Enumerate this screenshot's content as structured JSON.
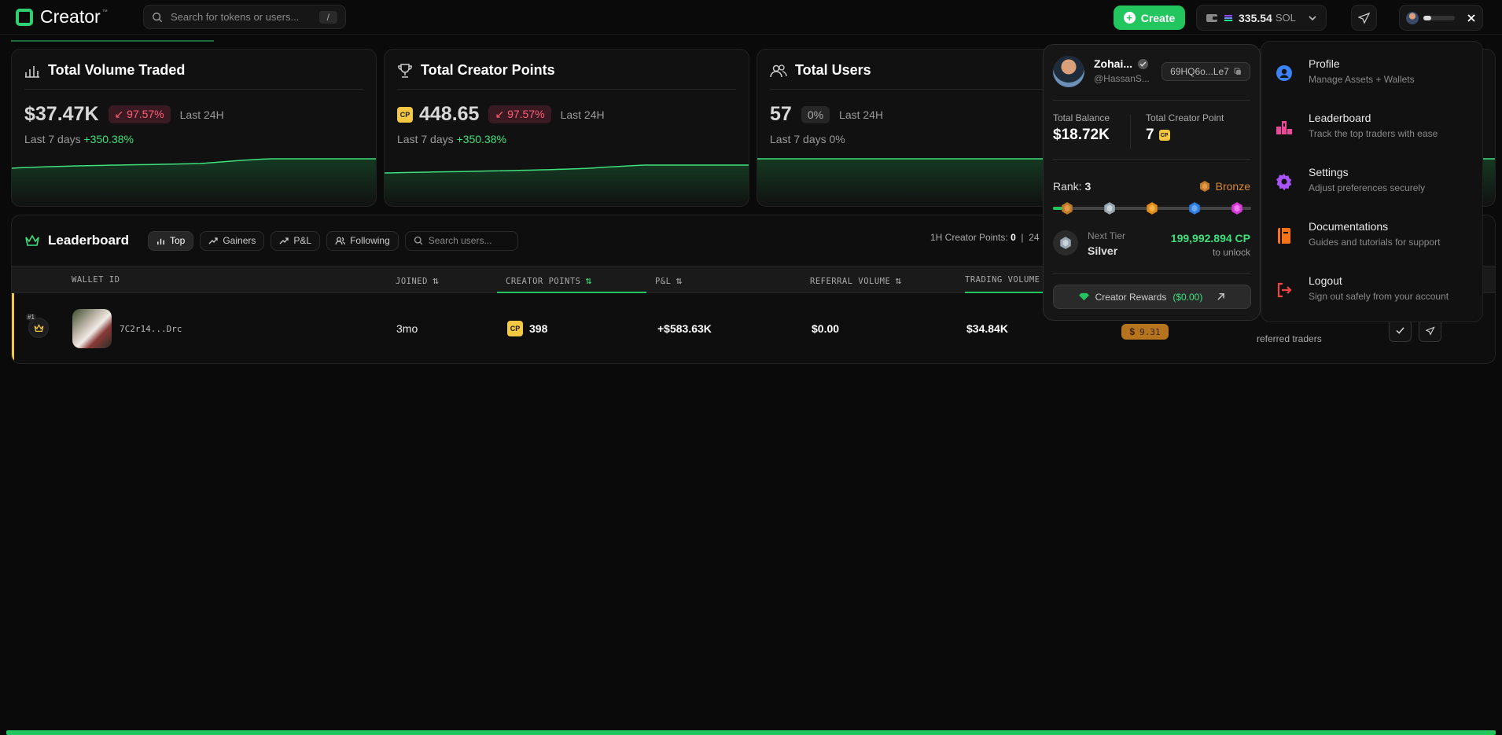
{
  "app": {
    "name": "Creator",
    "tm": "™"
  },
  "header": {
    "search_placeholder": "Search for tokens or users...",
    "search_shortcut": "/",
    "create_label": "Create",
    "balance": "335.54",
    "currency": "SOL"
  },
  "cards": [
    {
      "title": "Total Volume Traded",
      "value": "$37.47K",
      "change": "↙ 97.57%",
      "period": "Last 24H",
      "sub_label": "Last 7 days",
      "sub_value": "+350.38%"
    },
    {
      "title": "Total Creator Points",
      "value": "448.65",
      "change": "↙ 97.57%",
      "period": "Last 24H",
      "sub_label": "Last 7 days",
      "sub_value": "+350.38%"
    },
    {
      "title": "Total Users",
      "value": "57",
      "change": "0%",
      "period": "Last 24H",
      "sub_label": "Last 7 days 0%",
      "sub_value": ""
    }
  ],
  "leaderboard": {
    "title": "Leaderboard",
    "filters": [
      "Top",
      "Gainers",
      "P&L",
      "Following"
    ],
    "search_placeholder": "Search users...",
    "hour_stat_label": "1H Creator Points:",
    "hour_stat_value": "0",
    "hour_stat_more": "24",
    "columns": [
      "WALLET ID",
      "JOINED",
      "CREATOR POINTS",
      "P&L",
      "REFERRAL VOLUME",
      "TRADING VOLUME"
    ],
    "rows": [
      {
        "rank": "#1",
        "wallet": "7C2r14...Drc",
        "joined": "3mo",
        "creator_points": "398",
        "pnl": "+$583.63K",
        "referral_volume": "$0.00",
        "trading_volume": "$34.84K",
        "tier_value": "9.31",
        "referred": "referred traders"
      }
    ]
  },
  "profile": {
    "name": "Zohai...",
    "handle": "@HassanS...",
    "address": "69HQ6o...Le7",
    "total_balance_label": "Total Balance",
    "total_balance": "$18.72K",
    "total_cp_label": "Total Creator Point",
    "total_cp": "7",
    "rank_label": "Rank:",
    "rank": "3",
    "tier": "Bronze",
    "next_tier_label": "Next Tier",
    "next_tier": "Silver",
    "cp_needed": "199,992.894 CP",
    "unlock_label": "to unlock",
    "rewards_label": "Creator Rewards",
    "rewards_amount": "($0.00)"
  },
  "menu": [
    {
      "title": "Profile",
      "desc": "Manage Assets + Wallets",
      "icon": "user-icon",
      "color": "#3b82f6"
    },
    {
      "title": "Leaderboard",
      "desc": "Track the top traders with ease",
      "icon": "podium-icon",
      "color": "#ec4899"
    },
    {
      "title": "Settings",
      "desc": "Adjust preferences securely",
      "icon": "gear-icon",
      "color": "#a855f7"
    },
    {
      "title": "Documentations",
      "desc": "Guides and tutorials for support",
      "icon": "book-icon",
      "color": "#f97316"
    },
    {
      "title": "Logout",
      "desc": "Sign out safely from your account",
      "icon": "logout-icon",
      "color": "#ef4444"
    }
  ]
}
